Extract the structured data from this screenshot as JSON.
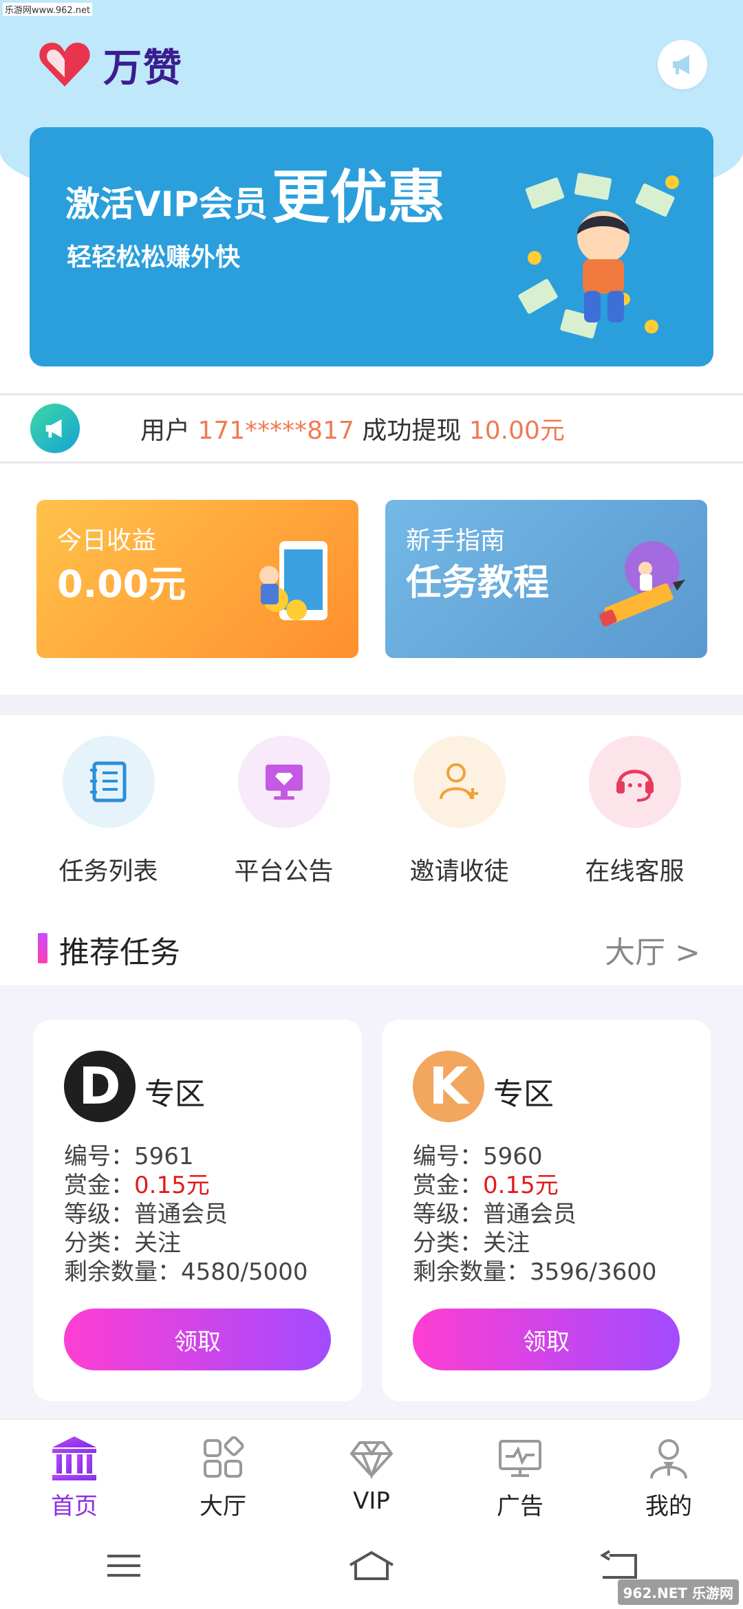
{
  "watermark_top": "乐游网www.962.net",
  "app": {
    "name": "万赞"
  },
  "banner": {
    "title_small": "激活VIP会员",
    "title_big": "更优惠",
    "subtitle": "轻轻松松赚外快"
  },
  "ticker": {
    "prefix": "用户",
    "user": "171*****817",
    "middle": "成功提现",
    "amount": "10.00元"
  },
  "cards": {
    "earnings": {
      "label": "今日收益",
      "value": "0.00元"
    },
    "guide": {
      "label": "新手指南",
      "value": "任务教程"
    }
  },
  "quick_links": [
    {
      "label": "任务列表",
      "icon": "notebook-icon",
      "bg": "#e6f3fb"
    },
    {
      "label": "平台公告",
      "icon": "monitor-diamond-icon",
      "bg": "#f8e9fb"
    },
    {
      "label": "邀请收徒",
      "icon": "add-user-icon",
      "bg": "#fdf1e1"
    },
    {
      "label": "在线客服",
      "icon": "headset-icon",
      "bg": "#fde4ea"
    }
  ],
  "section": {
    "title": "推荐任务",
    "more": "大厅 >"
  },
  "tasks": [
    {
      "letter": "D",
      "letter_bg": "#1f1f1f",
      "zone": "专区",
      "id_label": "编号：",
      "id": "5961",
      "reward_label": "赏金：",
      "reward": "0.15元",
      "level_label": "等级：",
      "level": "普通会员",
      "category_label": "分类：",
      "category": "关注",
      "remaining_label": "剩余数量：",
      "remaining": "4580/5000",
      "button": "领取"
    },
    {
      "letter": "K",
      "letter_bg": "#f2a65e",
      "zone": "专区",
      "id_label": "编号：",
      "id": "5960",
      "reward_label": "赏金：",
      "reward": "0.15元",
      "level_label": "等级：",
      "level": "普通会员",
      "category_label": "分类：",
      "category": "关注",
      "remaining_label": "剩余数量：",
      "remaining": "3596/3600",
      "button": "领取"
    }
  ],
  "nav": [
    {
      "label": "首页",
      "icon": "bank-icon",
      "active": true
    },
    {
      "label": "大厅",
      "icon": "grid-icon",
      "active": false
    },
    {
      "label": "VIP",
      "icon": "diamond-icon",
      "active": false
    },
    {
      "label": "广告",
      "icon": "monitor-icon",
      "active": false
    },
    {
      "label": "我的",
      "icon": "person-icon",
      "active": false
    }
  ],
  "watermark_br": "962.NET 乐游网",
  "colors": {
    "accent": "#8e2de2",
    "highlight": "#f07a52",
    "reward": "#e21b1b",
    "banner": "#2a9fdc"
  }
}
